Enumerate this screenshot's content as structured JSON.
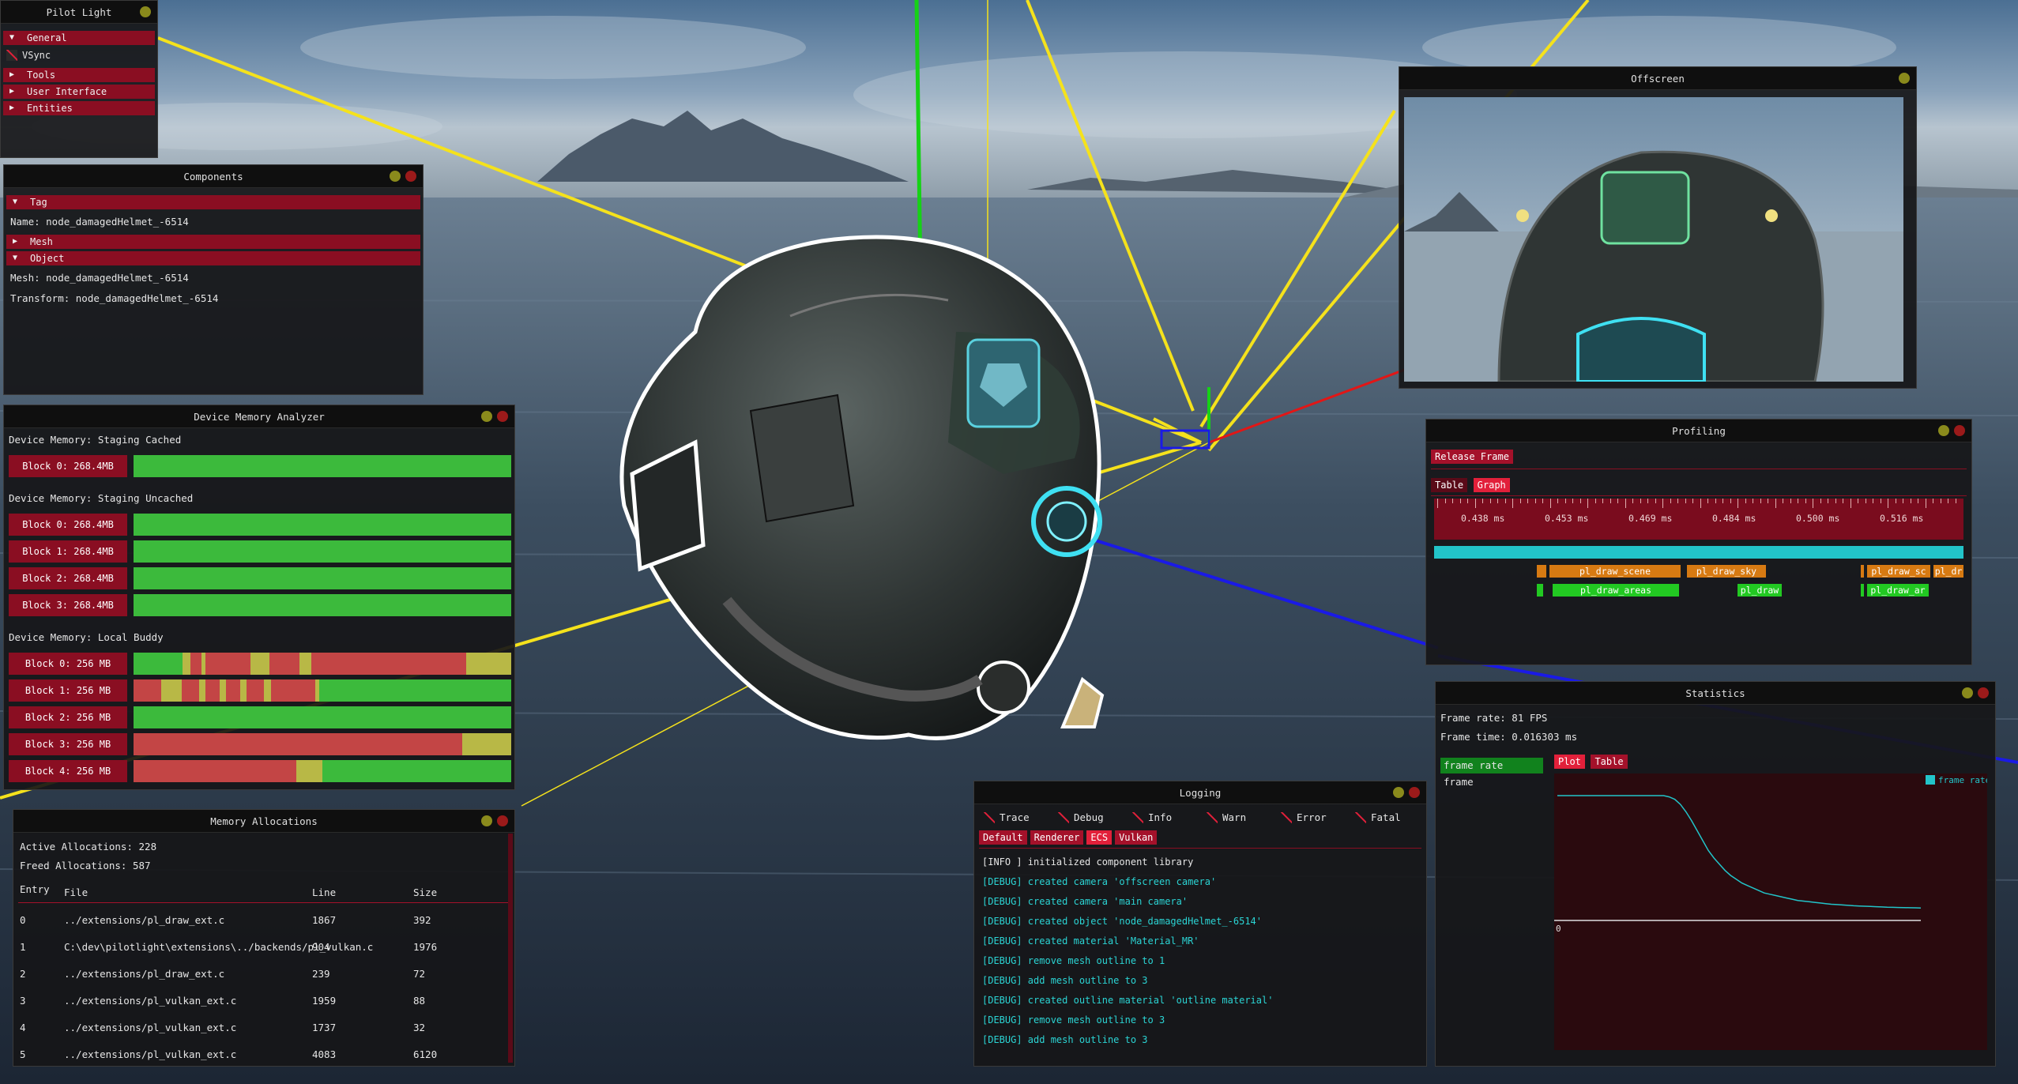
{
  "colors": {
    "accent": "#8a0e22",
    "accent_active": "#e2203a",
    "bar_green": "#3cba3c",
    "bar_red": "#c34545",
    "bar_yellow": "#b8b846",
    "log_cyan": "#2bd4d4",
    "pill_orange": "#d77a12",
    "pill_green": "#22c922",
    "flame_cyan": "#22c4c9"
  },
  "pilot_light": {
    "title": "Pilot Light",
    "menu": [
      {
        "arrow": "▼",
        "label": "General"
      },
      {
        "arrow": "",
        "label": "VSync",
        "checkbox": true
      },
      {
        "arrow": "▶",
        "label": "Tools"
      },
      {
        "arrow": "▶",
        "label": "User Interface"
      },
      {
        "arrow": "▶",
        "label": "Entities"
      }
    ]
  },
  "components": {
    "title": "Components",
    "tag_header": "Tag",
    "name_line": "Name: node_damagedHelmet_-6514",
    "mesh_header": "Mesh",
    "object_header": "Object",
    "mesh_line": "Mesh: node_damagedHelmet_-6514",
    "transform_line": "Transform: node_damagedHelmet_-6514"
  },
  "memory_analyzer": {
    "title": "Device Memory Analyzer",
    "groups": [
      {
        "label": "Device Memory: Staging Cached",
        "blocks": [
          {
            "label": "Block 0: 268.4MB",
            "segments": [
              [
                1.0,
                "green"
              ]
            ]
          }
        ]
      },
      {
        "label": "Device Memory: Staging Uncached",
        "blocks": [
          {
            "label": "Block 0: 268.4MB",
            "segments": [
              [
                1.0,
                "green"
              ]
            ]
          },
          {
            "label": "Block 1: 268.4MB",
            "segments": [
              [
                1.0,
                "green"
              ]
            ]
          },
          {
            "label": "Block 2: 268.4MB",
            "segments": [
              [
                1.0,
                "green"
              ]
            ]
          },
          {
            "label": "Block 3: 268.4MB",
            "segments": [
              [
                1.0,
                "green"
              ]
            ]
          }
        ]
      },
      {
        "label": "Device Memory: Local Buddy",
        "blocks": [
          {
            "label": "Block 0: 256 MB",
            "segments": [
              [
                0.13,
                "green"
              ],
              [
                0.02,
                "yellow"
              ],
              [
                0.03,
                "red"
              ],
              [
                0.01,
                "yellow"
              ],
              [
                0.12,
                "red"
              ],
              [
                0.05,
                "yellow"
              ],
              [
                0.08,
                "red"
              ],
              [
                0.03,
                "yellow"
              ],
              [
                0.41,
                "red"
              ],
              [
                0.12,
                "yellow"
              ]
            ]
          },
          {
            "label": "Block 1: 256 MB",
            "segments": [
              [
                0.08,
                "red"
              ],
              [
                0.06,
                "yellow"
              ],
              [
                0.05,
                "red"
              ],
              [
                0.02,
                "yellow"
              ],
              [
                0.04,
                "red"
              ],
              [
                0.02,
                "yellow"
              ],
              [
                0.04,
                "red"
              ],
              [
                0.02,
                "yellow"
              ],
              [
                0.05,
                "red"
              ],
              [
                0.02,
                "yellow"
              ],
              [
                0.13,
                "red"
              ],
              [
                0.01,
                "yellow"
              ],
              [
                0.56,
                "green"
              ]
            ]
          },
          {
            "label": "Block 2: 256 MB",
            "segments": [
              [
                1.0,
                "green"
              ]
            ]
          },
          {
            "label": "Block 3: 256 MB",
            "segments": [
              [
                0.87,
                "red"
              ],
              [
                0.13,
                "yellow"
              ]
            ]
          },
          {
            "label": "Block 4: 256 MB",
            "segments": [
              [
                0.43,
                "red"
              ],
              [
                0.07,
                "yellow"
              ],
              [
                0.5,
                "green"
              ]
            ]
          }
        ]
      }
    ]
  },
  "allocations": {
    "title": "Memory Allocations",
    "active": "Active Allocations: 228",
    "freed": "Freed Allocations: 587",
    "columns": [
      "Entry",
      "File",
      "Line",
      "Size"
    ],
    "rows": [
      [
        "0",
        "../extensions/pl_draw_ext.c",
        "1867",
        "392"
      ],
      [
        "1",
        "C:\\dev\\pilotlight\\extensions\\../backends/pl_vulkan.c",
        "904",
        "1976"
      ],
      [
        "2",
        "../extensions/pl_draw_ext.c",
        "239",
        "72"
      ],
      [
        "3",
        "../extensions/pl_vulkan_ext.c",
        "1959",
        "88"
      ],
      [
        "4",
        "../extensions/pl_vulkan_ext.c",
        "1737",
        "32"
      ],
      [
        "5",
        "../extensions/pl_vulkan_ext.c",
        "4083",
        "6120"
      ]
    ]
  },
  "offscreen": {
    "title": "Offscreen"
  },
  "profiling": {
    "title": "Profiling",
    "release_frame": "Release Frame",
    "tabs": [
      "Table",
      "Graph"
    ],
    "ticks": [
      "0.438 ms",
      "0.453 ms",
      "0.469 ms",
      "0.484 ms",
      "0.500 ms",
      "0.516 ms"
    ],
    "row1": [
      "pl_draw_scene",
      "pl_draw_sky",
      "pl_draw_sc",
      "pl_dr"
    ],
    "row2": [
      "pl_draw_areas",
      "pl_draw",
      "pl_draw_ar"
    ]
  },
  "statistics": {
    "title": "Statistics",
    "frame_rate": "Frame rate: 81 FPS",
    "frame_time": "Frame time: 0.016303 ms",
    "list": [
      "frame rate",
      "frame"
    ],
    "tabs": [
      "Plot",
      "Table"
    ],
    "legend": "frame rate",
    "zero_label": "0",
    "plot_values": [
      1,
      1,
      1,
      1,
      1,
      1,
      1,
      1,
      1,
      1,
      1,
      1,
      1,
      1,
      1,
      1,
      1,
      1,
      1,
      1,
      0.99,
      0.97,
      0.93,
      0.87,
      0.8,
      0.72,
      0.64,
      0.56,
      0.5,
      0.45,
      0.4,
      0.36,
      0.33,
      0.3,
      0.28,
      0.26,
      0.24,
      0.22,
      0.21,
      0.2,
      0.19,
      0.18,
      0.17,
      0.16,
      0.155,
      0.15,
      0.145,
      0.14,
      0.135,
      0.13,
      0.127,
      0.124,
      0.121,
      0.118,
      0.116,
      0.114,
      0.112,
      0.11,
      0.108,
      0.106,
      0.105,
      0.104,
      0.103,
      0.102,
      0.101,
      0.1
    ]
  },
  "logging": {
    "title": "Logging",
    "levels": [
      "Trace",
      "Debug",
      "Info",
      "Warn",
      "Error",
      "Fatal"
    ],
    "channels": [
      "Default",
      "Renderer",
      "ECS",
      "Vulkan"
    ],
    "lines": [
      {
        "text": "[INFO ] initialized component library",
        "kind": "info"
      },
      {
        "text": "[DEBUG] created camera 'offscreen camera'",
        "kind": "debug"
      },
      {
        "text": "[DEBUG] created camera 'main camera'",
        "kind": "debug"
      },
      {
        "text": "[DEBUG] created object 'node_damagedHelmet_-6514'",
        "kind": "debug"
      },
      {
        "text": "[DEBUG] created material 'Material_MR'",
        "kind": "debug"
      },
      {
        "text": "[DEBUG] remove mesh outline to 1",
        "kind": "debug"
      },
      {
        "text": "[DEBUG] add mesh outline to 3",
        "kind": "debug"
      },
      {
        "text": "[DEBUG] created outline material 'outline material'",
        "kind": "debug"
      },
      {
        "text": "[DEBUG] remove mesh outline to 3",
        "kind": "debug"
      },
      {
        "text": "[DEBUG] add mesh outline to 3",
        "kind": "debug"
      }
    ]
  }
}
